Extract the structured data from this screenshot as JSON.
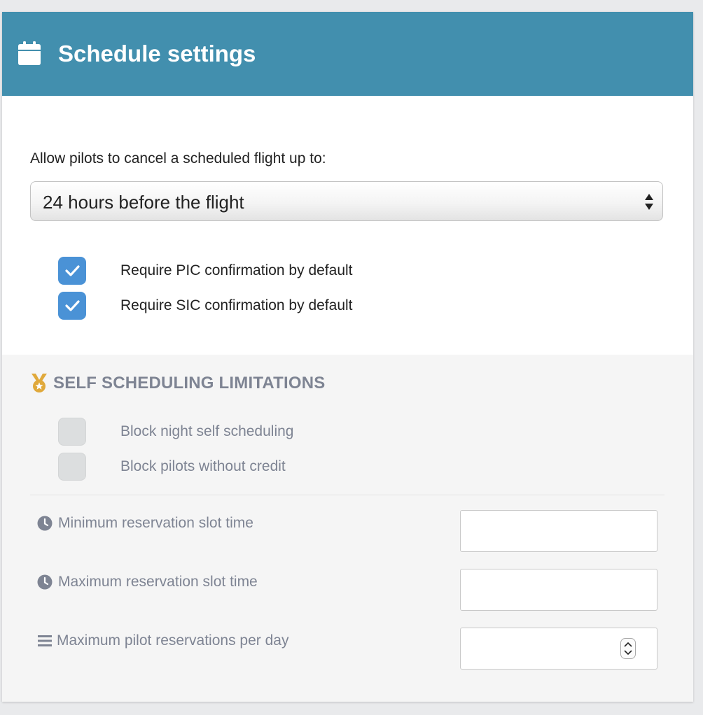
{
  "header": {
    "title": "Schedule settings",
    "icon": "calendar-icon",
    "background_color": "#428fae"
  },
  "cancel_policy": {
    "label": "Allow pilots to cancel a scheduled flight up to:",
    "selected": "24 hours before the flight"
  },
  "confirmations": [
    {
      "label": "Require PIC confirmation by default",
      "checked": true
    },
    {
      "label": "Require SIC confirmation by default",
      "checked": true
    }
  ],
  "limitations": {
    "title": "SELF SCHEDULING LIMITATIONS",
    "icon": "medal-icon",
    "checkboxes": [
      {
        "label": "Block night self scheduling",
        "checked": false
      },
      {
        "label": "Block pilots without credit",
        "checked": false
      }
    ],
    "fields": [
      {
        "label": "Minimum reservation slot time",
        "icon": "clock-icon",
        "value": ""
      },
      {
        "label": "Maximum reservation slot time",
        "icon": "clock-icon",
        "value": ""
      },
      {
        "label": "Maximum pilot reservations per day",
        "icon": "list-icon",
        "value": "",
        "type": "number"
      }
    ]
  },
  "colors": {
    "checkbox_checked": "#4a92d6",
    "muted_text": "#7e8493",
    "medal": "#e0a93b"
  }
}
